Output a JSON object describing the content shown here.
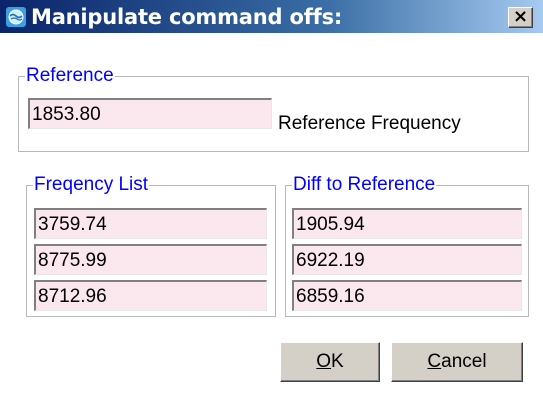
{
  "window": {
    "title": "Manipulate command offs:",
    "icon": "globe-app-icon",
    "close_label": "×"
  },
  "reference": {
    "group_title": "Reference",
    "value": "1853.80",
    "label": "Reference Frequency"
  },
  "frequency_list": {
    "group_title": "Freqency List",
    "values": [
      "3759.74",
      "8775.99",
      "8712.96"
    ]
  },
  "diff_to_reference": {
    "group_title": "Diff to Reference",
    "values": [
      "1905.94",
      "6922.19",
      "6859.16"
    ]
  },
  "buttons": {
    "ok_mnemonic": "O",
    "ok_rest": "K",
    "cancel_mnemonic": "C",
    "cancel_rest": "ancel"
  },
  "colors": {
    "title_gradient_start": "#0a246a",
    "title_gradient_end": "#a6caf0",
    "group_title": "#0000ff",
    "field_background": "#fbe8ee",
    "button_face": "#d4d0c8"
  }
}
